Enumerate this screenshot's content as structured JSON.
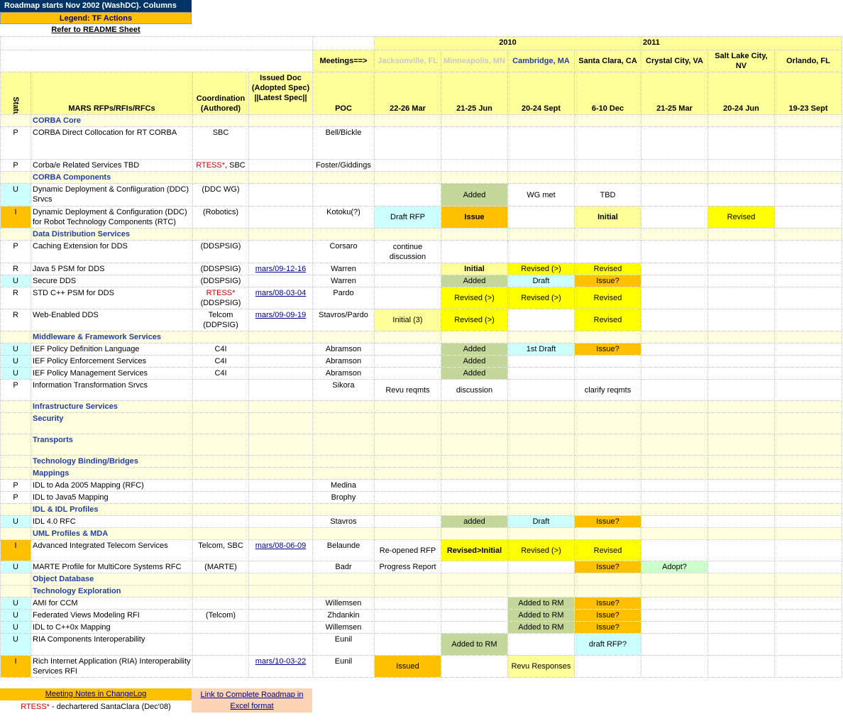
{
  "top": {
    "title": "Roadmap starts Nov 2002 (WashDC). Columns",
    "legend": "Legend: TF Actions",
    "readme": "Refer to README Sheet"
  },
  "header": {
    "years": {
      "y2010": "2010",
      "y2011": "2011"
    },
    "meetings_label": "Meetings==>",
    "locations": [
      "Jacksonville, FL",
      "Minneapolis, MN",
      "Cambridge, MA",
      "Santa Clara, CA",
      "Crystal City, VA",
      "Salt Lake City, NV",
      "Orlando, FL"
    ],
    "dates": [
      "22-26 Mar",
      "21-25 Jun",
      "20-24 Sept",
      "6-10 Dec",
      "21-25 Mar",
      "20-24 Jun",
      "19-23 Sept"
    ],
    "status": "Status",
    "rfps": "MARS RFPs/RFIs/RFCs",
    "coordination": "Coordination (Authored)",
    "issued": "Issued Doc (Adopted Spec) ||Latest Spec||",
    "poc": "POC"
  },
  "rows": [
    {
      "type": "section",
      "title": "CORBA Core"
    },
    {
      "status": "P",
      "name": "CORBA Direct Collocation for RT CORBA",
      "coord": "SBC",
      "doc": "",
      "poc": "Bell/Bickle",
      "cells": [
        "",
        "",
        "",
        "",
        "",
        "",
        ""
      ],
      "h": 46
    },
    {
      "status": "P",
      "name": "Corba/e Related Services TBD",
      "coord_red": "RTESS*",
      "coord": ", SBC",
      "doc": "",
      "poc": "Foster/Giddings",
      "cells": [
        "",
        "",
        "",
        "",
        "",
        "",
        ""
      ]
    },
    {
      "type": "section",
      "title": "CORBA Components"
    },
    {
      "status": "U",
      "name": "Dynamic Deployment & Confiiguration (DDC) Srvcs",
      "coord": "(DDC WG)",
      "doc": "",
      "poc": "",
      "cells": [
        "",
        "Added",
        "WG met",
        "TBD",
        "",
        "",
        ""
      ],
      "h": 32
    },
    {
      "status": "I",
      "name": "Dynamic Deployment & Configuration (DDC) for Robot Technology Components (RTC)",
      "coord": "(Robotics)",
      "doc": "",
      "poc": "Kotoku(?)",
      "cells": [
        "Draft RFP",
        "Issue",
        "",
        "Initial",
        "",
        "Revised",
        ""
      ],
      "h": 30
    },
    {
      "type": "section",
      "title": "Data Distribution Services"
    },
    {
      "status": "P",
      "name": "Caching Extension for DDS",
      "coord": "(DDSPSIG)",
      "doc": "",
      "poc": "Corsaro",
      "cells": [
        "continue discussion",
        "",
        "",
        "",
        "",
        "",
        ""
      ],
      "h": 32
    },
    {
      "status": "R",
      "name": "Java 5 PSM for DDS",
      "coord": "(DDSPSIG)",
      "doc": "mars/09-12-16",
      "poc": "Warren",
      "cells": [
        "",
        "Initial",
        "Revised (>)",
        "Revised",
        "",
        "",
        ""
      ]
    },
    {
      "status": "U",
      "name": "Secure DDS",
      "coord": "(DDSPSIG)",
      "doc": "",
      "poc": "Warren",
      "cells": [
        "",
        "Added",
        "Draft",
        "Issue?",
        "",
        "",
        ""
      ]
    },
    {
      "status": "R",
      "name": "STD C++ PSM  for DDS",
      "coord_red": "RTESS*",
      "coord": "(DDSPSIG)",
      "doc": "mars/08-03-04",
      "poc": "Pardo",
      "cells": [
        "",
        "Revised (>)",
        "Revised (>)",
        "Revised",
        "",
        "",
        ""
      ],
      "h": 30
    },
    {
      "status": "R",
      "name": "Web-Enabled DDS",
      "coord": "Telcom (DDPSIG)",
      "doc": "mars/09-09-19",
      "poc": "Stavros/Pardo",
      "cells": [
        "Initial (3)",
        "Revised (>)",
        "",
        "Revised",
        "",
        "",
        ""
      ],
      "h": 30
    },
    {
      "type": "section",
      "title": "Middleware & Framework Services"
    },
    {
      "status": "U",
      "name": "IEF Policy Definition Language",
      "coord": "C4I",
      "doc": "",
      "poc": "Abramson",
      "cells": [
        "",
        "Added",
        "1st Draft",
        "Issue?",
        "",
        "",
        ""
      ]
    },
    {
      "status": "U",
      "name": "IEF Policy Enforcement Services",
      "coord": "C4I",
      "doc": "",
      "poc": "Abramson",
      "cells": [
        "",
        "Added",
        "",
        "",
        "",
        "",
        ""
      ]
    },
    {
      "status": "U",
      "name": "IEF Policy Management Services",
      "coord": "C4I",
      "doc": "",
      "poc": "Abramson",
      "cells": [
        "",
        "Added",
        "",
        "",
        "",
        "",
        ""
      ]
    },
    {
      "status": "P",
      "name": "Information Transformation Srvcs",
      "coord": "",
      "doc": "",
      "poc": "Sikora",
      "cells": [
        "Revu reqmts",
        "discussion",
        "",
        "clarify reqmts",
        "",
        "",
        ""
      ],
      "h": 30
    },
    {
      "type": "section",
      "title": "Infrastructure Services"
    },
    {
      "type": "section",
      "title": "Security",
      "h": 30
    },
    {
      "type": "section",
      "title": "Transports",
      "h": 30
    },
    {
      "type": "section",
      "title": "Technology Binding/Bridges"
    },
    {
      "type": "section",
      "title": "Mappings"
    },
    {
      "status": "P",
      "name": "IDL to Ada 2005 Mapping (RFC)",
      "coord": "",
      "doc": "",
      "poc": "Medina",
      "cells": [
        "",
        "",
        "",
        "",
        "",
        "",
        ""
      ]
    },
    {
      "status": "P",
      "name": "IDL to Java5 Mapping",
      "coord": "",
      "doc": "",
      "poc": "Brophy",
      "cells": [
        "",
        "",
        "",
        "",
        "",
        "",
        ""
      ]
    },
    {
      "type": "section",
      "title": "IDL & IDL Profiles"
    },
    {
      "status": "U",
      "name": "IDL 4.0 RFC",
      "coord": "",
      "doc": "",
      "poc": "Stavros",
      "cells": [
        "",
        "added",
        "Draft",
        "Issue?",
        "",
        "",
        ""
      ]
    },
    {
      "type": "section",
      "title": "UML Profiles & MDA"
    },
    {
      "status": "I",
      "name": "Advanced Integrated Telecom Services",
      "coord": "Telcom, SBC",
      "doc": "mars/08-06-09",
      "poc": "Belaunde",
      "cells": [
        "Re-opened RFP",
        "Revised>Initial",
        "Revised (>)",
        "Revised",
        "",
        "",
        ""
      ],
      "h": 30
    },
    {
      "status": "U",
      "name": "MARTE Profile for MultiCore Systems RFC",
      "coord": "(MARTE)",
      "doc": "",
      "poc": "Badr",
      "cells": [
        "Progress Report",
        "",
        "",
        "Issue?",
        "Adopt?",
        "",
        ""
      ]
    },
    {
      "type": "section",
      "title": "Object Database"
    },
    {
      "type": "section",
      "title": "Technology Exploration"
    },
    {
      "status": "U",
      "name": "AMI for CCM",
      "coord": "",
      "doc": "",
      "poc": "Willemsen",
      "cells": [
        "",
        "",
        "Added to RM",
        "Issue?",
        "",
        "",
        ""
      ]
    },
    {
      "status": "U",
      "name": "Federated Views Modeling RFI",
      "coord": "(Telcom)",
      "doc": "",
      "poc": "Zhdankin",
      "cells": [
        "",
        "",
        "Added to RM",
        "Issue?",
        "",
        "",
        ""
      ]
    },
    {
      "status": "U",
      "name": "IDL to C++0x Mapping",
      "coord": "",
      "doc": "",
      "poc": "Willemsen",
      "cells": [
        "",
        "",
        "Added to RM",
        "Issue?",
        "",
        "",
        ""
      ]
    },
    {
      "status": "U",
      "name": "RIA Components Interoperability",
      "coord": "",
      "doc": "",
      "poc": "Eunil",
      "cells": [
        "",
        "Added to RM",
        "",
        "draft RFP?",
        "",
        "",
        ""
      ],
      "h": 31
    },
    {
      "status": "I",
      "name": "Rich Internet Application (RIA) Interoperability Services RFI",
      "coord": "",
      "doc": "mars/10-03-22",
      "poc": "Eunil",
      "cells": [
        "Issued",
        "",
        "Revu Responses",
        "",
        "",
        "",
        ""
      ],
      "h": 30
    }
  ],
  "colors": {
    "Added": "green",
    "added": "green",
    "Added to RM": "green",
    "Issue": "orange",
    "Issue?": "orange",
    "Issued": "orange",
    "Revised (>)": "yellow",
    "Revised": "yellow",
    "Revised>Initial": "yellow",
    "Initial": "ltyellow",
    "Draft RFP": "cyan",
    "Draft": "cyan",
    "1st Draft": "cyan",
    "draft RFP?": "cyan",
    "Initial (3)": "ltyellow",
    "Revu Responses": "ltyellow",
    "Adopt?": "ltgreen"
  },
  "footer": {
    "meeting_notes": "Meeting Notes in ChangeLog",
    "link_roadmap": "Link to Complete Roadmap in Excel format",
    "rtess_note_red": "RTESS*",
    "rtess_note": " - dechartered SantaClara (Dec'08)"
  }
}
